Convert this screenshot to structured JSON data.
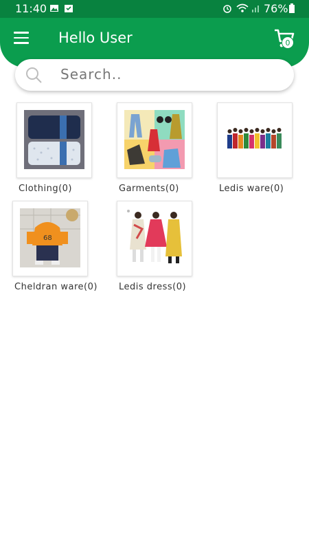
{
  "status_bar": {
    "time": "11:40",
    "battery": "76%"
  },
  "header": {
    "title": "Hello User",
    "cart_count": "0"
  },
  "search": {
    "placeholder": "Search.."
  },
  "categories": [
    {
      "label": "Clothing(0)"
    },
    {
      "label": "Garments(0)"
    },
    {
      "label": "Ledis ware(0)"
    },
    {
      "label": "Cheldran ware(0)"
    },
    {
      "label": "Ledis dress(0)"
    }
  ],
  "colors": {
    "header": "#0b9d4e",
    "status_bar": "#08823f"
  }
}
